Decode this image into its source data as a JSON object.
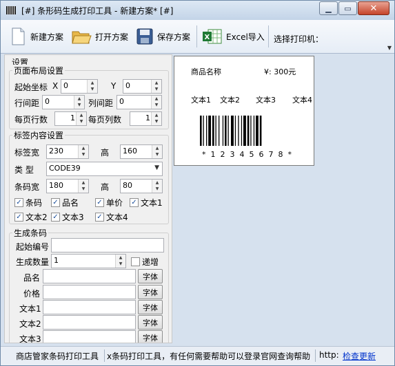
{
  "window": {
    "title": "[#] 条形码生成打印工具 - 新建方案* [#]",
    "min_label": "▁",
    "max_label": "▭",
    "close_label": "✕"
  },
  "toolbar": {
    "new_label": "新建方案",
    "open_label": "打开方案",
    "save_label": "保存方案",
    "excel_label": "Excel导入",
    "printer_label": "选择打印机：",
    "new_icon": "document-icon",
    "open_icon": "folder-icon",
    "save_icon": "floppy-icon",
    "excel_icon": "excel-icon"
  },
  "settings": {
    "title": "设置",
    "layout": {
      "title": "页面布局设置",
      "start_label": "起始坐标",
      "x_label": "X",
      "x_value": "0",
      "y_label": "Y",
      "y_value": "0",
      "row_gap_label": "行间距",
      "row_gap_value": "0",
      "col_gap_label": "列间距",
      "col_gap_value": "0",
      "rows_label": "每页行数",
      "rows_value": "1",
      "cols_label": "每页列数",
      "cols_value": "1"
    },
    "content": {
      "title": "标签内容设置",
      "width_label": "标签宽",
      "width_value": "230",
      "height_label": "高",
      "height_value": "160",
      "type_label": "类  型",
      "type_value": "CODE39",
      "bc_width_label": "条码宽",
      "bc_width_value": "180",
      "bc_height_label": "高",
      "bc_height_value": "80",
      "checks": [
        {
          "label": "条码",
          "checked": "✓"
        },
        {
          "label": "品名",
          "checked": "✓"
        },
        {
          "label": "单价",
          "checked": "✓"
        },
        {
          "label": "文本1",
          "checked": "✓"
        },
        {
          "label": "文本2",
          "checked": "✓"
        },
        {
          "label": "文本3",
          "checked": "✓"
        },
        {
          "label": "文本4",
          "checked": "✓"
        }
      ]
    },
    "generate": {
      "title": "生成条码",
      "start_no_label": "起始编号",
      "start_no_value": "",
      "count_label": "生成数量",
      "count_value": "1",
      "increment_label": "递增",
      "fields": [
        {
          "label": "品名",
          "value": "",
          "button": "字体"
        },
        {
          "label": "价格",
          "value": "",
          "button": "字体"
        },
        {
          "label": "文本1",
          "value": "",
          "button": "字体"
        },
        {
          "label": "文本2",
          "value": "",
          "button": "字体"
        },
        {
          "label": "文本3",
          "value": "",
          "button": "字体"
        }
      ]
    }
  },
  "preview": {
    "product_name": "商品名称",
    "price": "¥: 300元",
    "text1": "文本1",
    "text2": "文本2",
    "text3": "文本3",
    "text4": "文本4",
    "barcode_digits": "*12345678*"
  },
  "status": {
    "left": "商店管家条码打印工具",
    "middle": "x条码打印工具，有任何需要帮助可以登录官网查询帮助",
    "http_label": "http:",
    "update_link": "检查更新"
  }
}
